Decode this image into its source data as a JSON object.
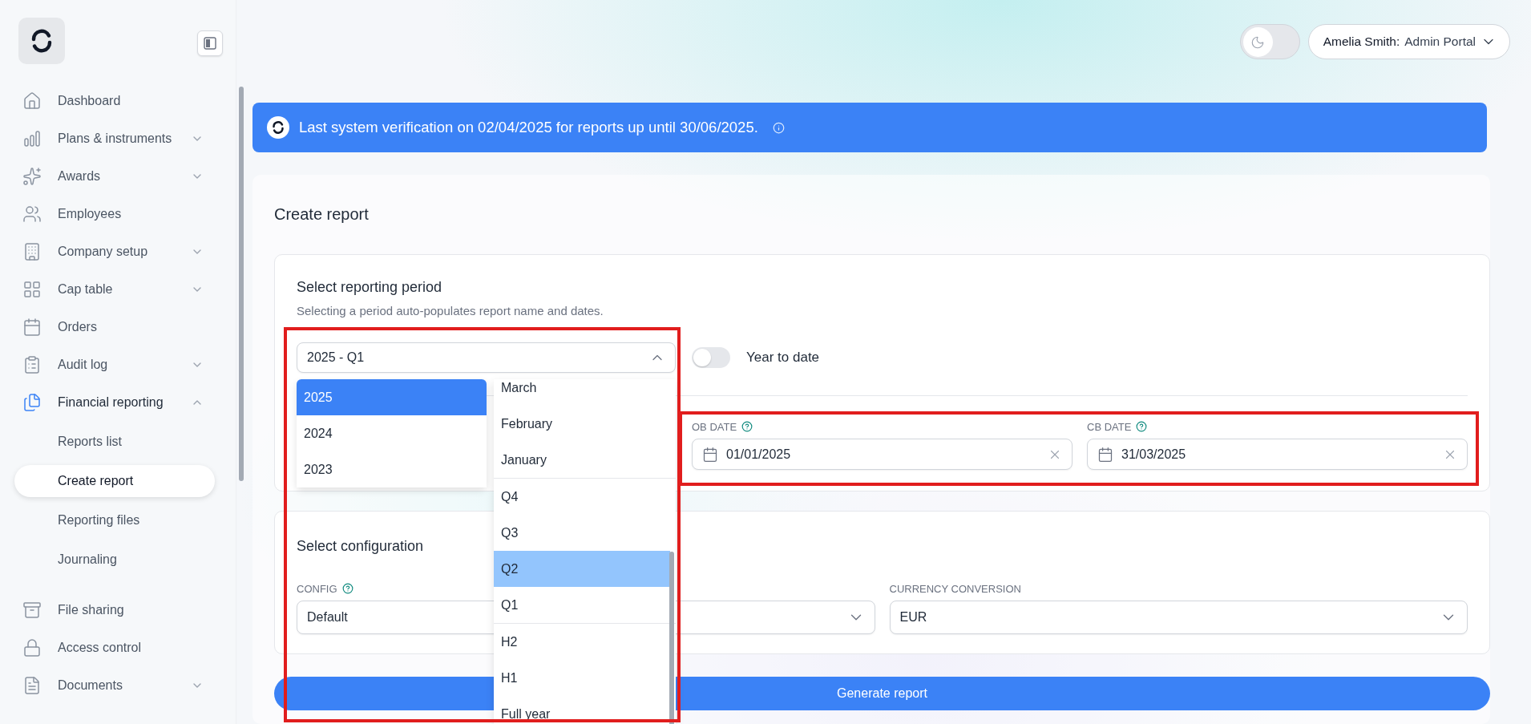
{
  "sidebar": {
    "items": [
      {
        "label": "Dashboard",
        "selected": false
      },
      {
        "label": "Plans & instruments",
        "selected": false,
        "expanded": false
      },
      {
        "label": "Awards",
        "selected": false,
        "expanded": false
      },
      {
        "label": "Employees",
        "selected": false
      },
      {
        "label": "Company setup",
        "selected": false,
        "expanded": false
      },
      {
        "label": "Cap table",
        "selected": false,
        "expanded": false
      },
      {
        "label": "Orders",
        "selected": false
      },
      {
        "label": "Audit log",
        "selected": false,
        "expanded": false
      },
      {
        "label": "Financial reporting",
        "selected": true,
        "expanded": true,
        "children": [
          {
            "label": "Reports list",
            "selected": false
          },
          {
            "label": "Create report",
            "selected": true
          },
          {
            "label": "Reporting files",
            "selected": false
          },
          {
            "label": "Journaling",
            "selected": false
          }
        ]
      },
      {
        "label": "File sharing",
        "selected": false
      },
      {
        "label": "Access control",
        "selected": false
      },
      {
        "label": "Documents",
        "selected": false,
        "expanded": false
      }
    ]
  },
  "header": {
    "dark_mode": false,
    "user": {
      "name": "Amelia Smith:",
      "portal": "Admin Portal"
    }
  },
  "banner": {
    "text": "Last system verification on 02/04/2025 for reports up until 30/06/2025."
  },
  "page_title": "Create report",
  "period_section": {
    "title": "Select reporting period",
    "subtitle": "Selecting a period auto-populates report name and dates.",
    "period_select": {
      "value": "2025 - Q1",
      "expanded": true
    },
    "year_to_date": {
      "label": "Year to date",
      "on": false
    },
    "years": [
      {
        "label": "2025",
        "selected": true
      },
      {
        "label": "2024",
        "selected": false
      },
      {
        "label": "2023",
        "selected": false
      }
    ],
    "period_groups": [
      {
        "items": [
          {
            "label": "March",
            "selected": false
          },
          {
            "label": "February",
            "selected": false
          },
          {
            "label": "January",
            "selected": false
          }
        ]
      },
      {
        "items": [
          {
            "label": "Q4",
            "selected": false
          },
          {
            "label": "Q3",
            "selected": false
          },
          {
            "label": "Q2",
            "selected": true
          },
          {
            "label": "Q1",
            "selected": false
          }
        ]
      },
      {
        "items": [
          {
            "label": "H2",
            "selected": false
          },
          {
            "label": "H1",
            "selected": false
          },
          {
            "label": "Full year",
            "selected": false
          }
        ]
      }
    ],
    "dates": [
      {
        "label": "OB DATE",
        "value": "01/01/2025"
      },
      {
        "label": "CB DATE",
        "value": "31/03/2025"
      }
    ]
  },
  "configuration": {
    "title": "Select configuration",
    "fields": [
      {
        "label": "CONFIG",
        "help": true,
        "value": "Default"
      },
      {
        "label": "CURRENCY CONVERSION",
        "value": "EUR"
      }
    ]
  },
  "generate_button": "Generate report"
}
